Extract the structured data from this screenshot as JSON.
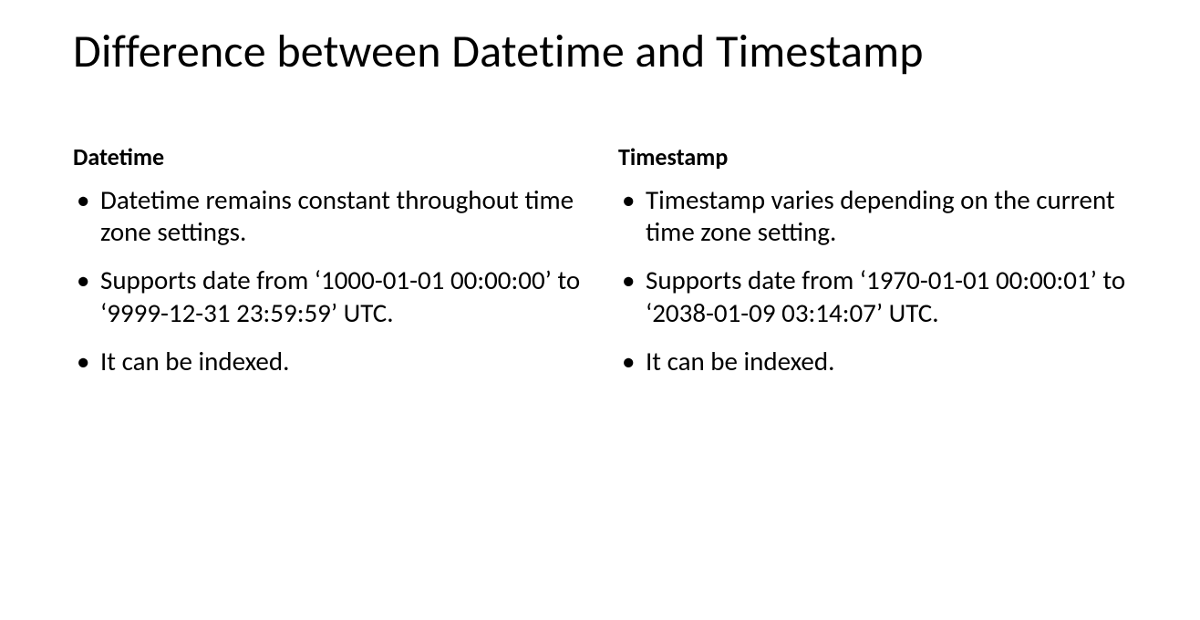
{
  "title": "Difference between Datetime and Timestamp",
  "left": {
    "heading": "Datetime",
    "items": [
      "Datetime remains constant throughout time zone settings.",
      "Supports date from ‘1000-01-01 00:00:00’ to ‘9999-12-31 23:59:59’ UTC.",
      "It can be indexed."
    ]
  },
  "right": {
    "heading": "Timestamp",
    "items": [
      "Timestamp varies depending on the current time zone setting.",
      "Supports date from ‘1970-01-01 00:00:01’ to ‘2038-01-09 03:14:07’ UTC.",
      "It can be indexed."
    ]
  }
}
